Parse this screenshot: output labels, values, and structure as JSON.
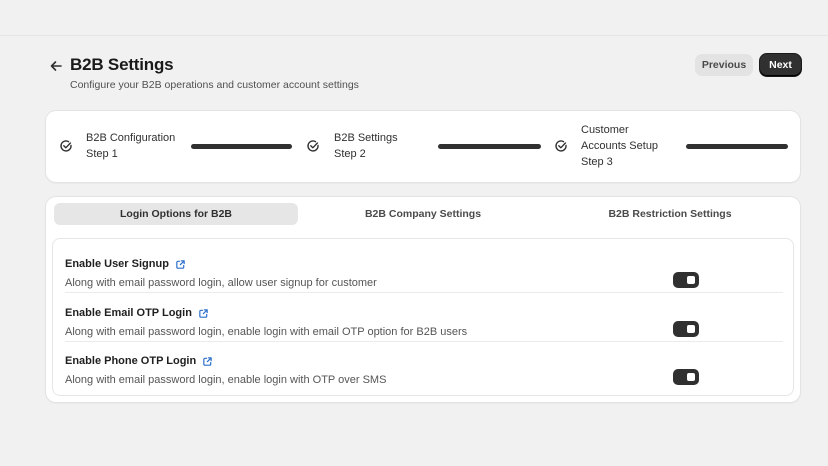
{
  "header": {
    "title": "B2B Settings",
    "subtitle": "Configure your B2B operations and customer account settings",
    "back_icon": "arrow-left-icon",
    "previous_label": "Previous",
    "next_label": "Next"
  },
  "steps": [
    {
      "name": "B2B Configuration",
      "step": "Step 1",
      "icon": "check-circle-icon"
    },
    {
      "name": "B2B Settings",
      "step": "Step 2",
      "icon": "check-circle-icon"
    },
    {
      "name": "Customer Accounts Setup",
      "step": "Step 3",
      "icon": "check-circle-icon"
    }
  ],
  "tabs": [
    {
      "label": "Login Options for B2B",
      "active": true
    },
    {
      "label": "B2B Company Settings",
      "active": false
    },
    {
      "label": "B2B Restriction Settings",
      "active": false
    }
  ],
  "options": [
    {
      "title": "Enable User Signup",
      "description": "Along with email password login, allow user signup for customer",
      "enabled": true
    },
    {
      "title": "Enable Email OTP Login",
      "description": "Along with email password login, enable login with email OTP option for B2B users",
      "enabled": true
    },
    {
      "title": "Enable Phone OTP Login",
      "description": "Along with email password login, enable login with OTP over SMS",
      "enabled": true
    }
  ],
  "colors": {
    "background": "#f1f1f1",
    "primary": "#303030",
    "link_icon": "#2c6ecb"
  }
}
